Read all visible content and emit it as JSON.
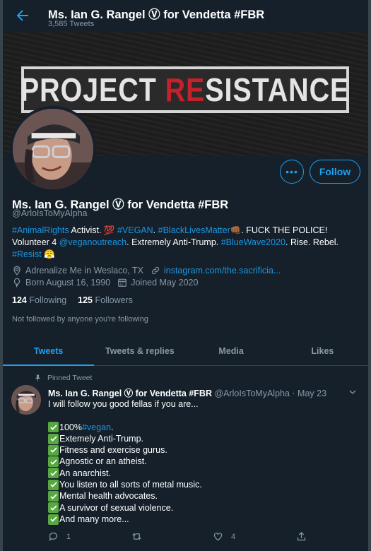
{
  "header": {
    "title": "Ms. Ian G. Rangel Ⓥ for Vendetta #FBR",
    "tweet_count": "3,585 Tweets"
  },
  "banner": {
    "text_left": "PROJECT ",
    "text_red": "RE",
    "text_right": "SISTANCE"
  },
  "buttons": {
    "more": "•••",
    "follow": "Follow"
  },
  "profile": {
    "name": "Ms. Ian G. Rangel Ⓥ for Vendetta #FBR",
    "handle": "@ArloIsToMyAlpha",
    "bio": {
      "t1": "#AnimalRights",
      "t2": " Activist. 💯 ",
      "t3": "#VEGAN",
      "t4": ". ",
      "t5": "#BlackLivesMatter",
      "t6": "👊🏾. FUCK THE POLICE! Volunteer 4 ",
      "t7": "@veganoutreach",
      "t8": ". Extremely Anti-Trump. ",
      "t9": "#BlueWave2020",
      "t10": ". Rise. Rebel. ",
      "t11": "#Resist",
      "t12": " 😤"
    },
    "location": "Adrenalize Me in Weslaco, TX",
    "website": "instagram.com/the.sacrificia...",
    "born": "Born August 16, 1990",
    "joined": "Joined May 2020",
    "following_count": "124",
    "following_label": " Following",
    "followers_count": "125",
    "followers_label": " Followers",
    "not_followed": "Not followed by anyone you're following"
  },
  "tabs": [
    "Tweets",
    "Tweets & replies",
    "Media",
    "Likes"
  ],
  "tweet": {
    "pinned_label": "Pinned Tweet",
    "name": "Ms. Ian G. Rangel Ⓥ for Vendetta #FBR",
    "meta": " @ArloIsToMyAlpha · May 23",
    "intro": "I will follow you good fellas if you are...",
    "items": [
      {
        "pre": "100% ",
        "tag": "#vegan",
        "post": "."
      },
      {
        "pre": "Extemely Anti-Trump.",
        "tag": "",
        "post": ""
      },
      {
        "pre": "Fitness and exercise gurus.",
        "tag": "",
        "post": ""
      },
      {
        "pre": "Agnostic or an atheist.",
        "tag": "",
        "post": ""
      },
      {
        "pre": "An anarchist.",
        "tag": "",
        "post": ""
      },
      {
        "pre": "You listen to all sorts of metal music.",
        "tag": "",
        "post": ""
      },
      {
        "pre": "Mental health advocates.",
        "tag": "",
        "post": ""
      },
      {
        "pre": "A survivor of sexual violence.",
        "tag": "",
        "post": ""
      },
      {
        "pre": "And many more...",
        "tag": "",
        "post": ""
      }
    ],
    "reply_count": "1",
    "retweet_count": "",
    "like_count": "4"
  },
  "colors": {
    "background": "#15202b",
    "accent": "#1da1f2",
    "secondary_text": "#8899a6",
    "banner_red": "#c3212b",
    "check_green": "#57a840"
  }
}
